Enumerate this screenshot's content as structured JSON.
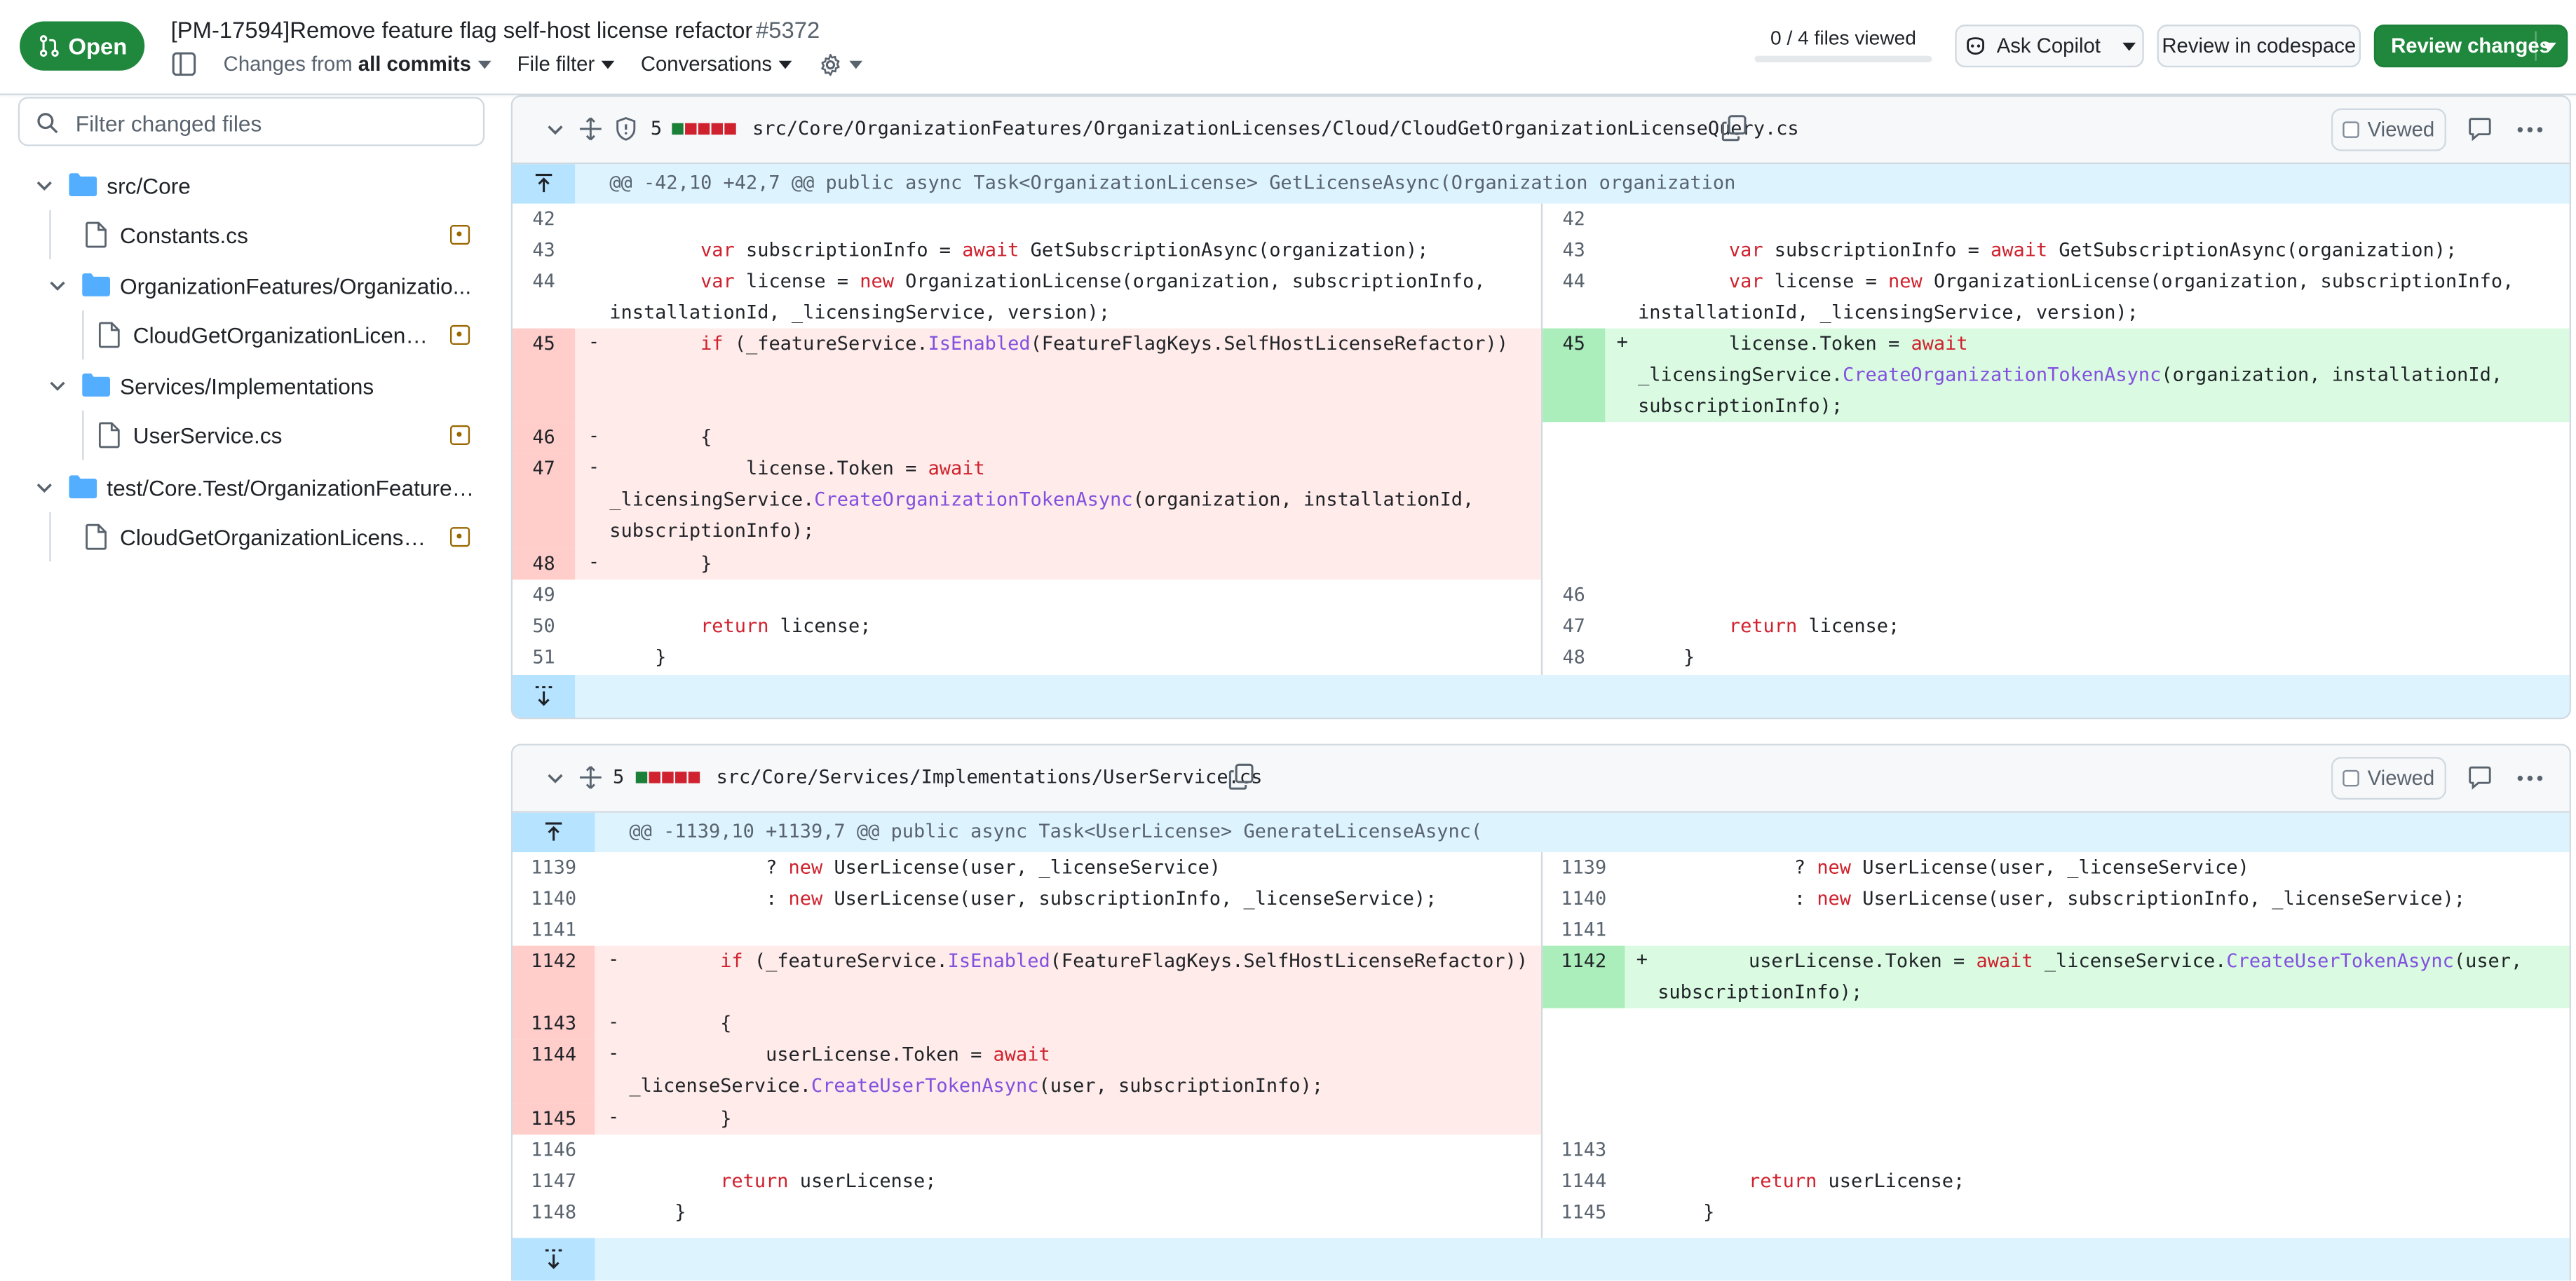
{
  "header": {
    "state_label": "Open",
    "pr_title": "[PM-17594]Remove feature flag self-host license refactor",
    "pr_number": "#5372",
    "changes_from_prefix": "Changes from",
    "changes_from_value": "all commits",
    "file_filter": "File filter",
    "conversations": "Conversations",
    "files_viewed": "0 / 4 files viewed",
    "files_viewed_progress": 0,
    "ask_copilot": "Ask Copilot",
    "review_in_codespace": "Review in codespace",
    "review_changes": "Review changes"
  },
  "sidebar": {
    "filter_placeholder": "Filter changed files",
    "tree": [
      {
        "type": "folder",
        "label": "src/Core"
      },
      {
        "type": "file",
        "label": "Constants.cs"
      },
      {
        "type": "folder",
        "label": "OrganizationFeatures/Organizatio..."
      },
      {
        "type": "file",
        "label": "CloudGetOrganizationLicens..."
      },
      {
        "type": "folder",
        "label": "Services/Implementations"
      },
      {
        "type": "file",
        "label": "UserService.cs"
      },
      {
        "type": "folder",
        "label": "test/Core.Test/OrganizationFeatures..."
      },
      {
        "type": "file",
        "label": "CloudGetOrganizationLicense..."
      }
    ]
  },
  "files": [
    {
      "changes": "5",
      "path": "src/Core/OrganizationFeatures/OrganizationLicenses/Cloud/CloudGetOrganizationLicenseQuery.cs",
      "viewed_label": "Viewed",
      "hunk": "@@ -42,10 +42,7 @@ public async Task<OrganizationLicense> GetLicenseAsync(Organization organization"
    },
    {
      "changes": "5",
      "path": "src/Core/Services/Implementations/UserService.cs",
      "viewed_label": "Viewed",
      "hunk": "@@ -1139,10 +1139,7 @@ public async Task<UserLicense> GenerateLicenseAsync("
    }
  ],
  "diff1": {
    "l42": "42",
    "r42": "42",
    "l43": "43",
    "r43": "43",
    "l44": "44",
    "r44": "44",
    "l45": "45",
    "r45": "45",
    "l46": "46",
    "l47": "47",
    "l48": "48",
    "l49": "49",
    "r46": "46",
    "l50": "50",
    "r47": "47",
    "l51": "51",
    "r48": "48"
  },
  "diff2": {
    "l1139": "1139",
    "r1139": "1139",
    "l1140": "1140",
    "r1140": "1140",
    "l1141": "1141",
    "r1141": "1141",
    "l1142": "1142",
    "r1142": "1142",
    "l1143": "1143",
    "l1144": "1144",
    "l1145": "1145",
    "l1146": "1146",
    "r1143": "1143",
    "l1147": "1147",
    "r1144": "1144",
    "l1148": "1148",
    "r1145": "1145"
  },
  "colors": {
    "open_green": "#1f883d",
    "deletion_bg": "#ffebe9",
    "addition_bg": "#dafbe1",
    "hunk_bg": "#ddf4ff",
    "keyword": "#cf222e",
    "function": "#8250df"
  },
  "icons": [
    "git-pull-request-icon",
    "sidebar-toggle-icon",
    "gear-icon",
    "search-icon",
    "chevron-down-icon",
    "folder-icon",
    "file-icon",
    "file-modified-icon",
    "shield-icon",
    "move-icon",
    "copy-icon",
    "comment-icon",
    "kebab-icon",
    "expand-up-icon",
    "expand-down-icon",
    "copilot-icon"
  ]
}
